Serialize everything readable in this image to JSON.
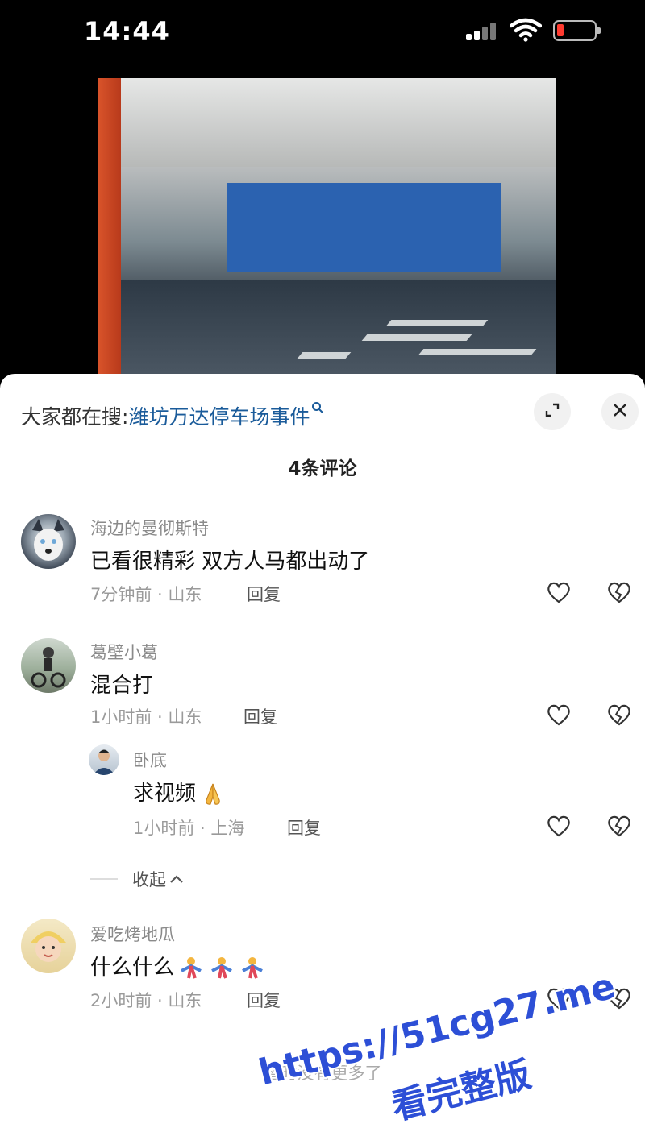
{
  "status_bar": {
    "time": "14:44"
  },
  "search": {
    "prefix": "大家都在搜:",
    "term": "潍坊万达停车场事件"
  },
  "comments_header": {
    "count_label": "4条评论"
  },
  "comments": [
    {
      "username": "海边的曼彻斯特",
      "text": "已看很精彩 双方人马都出动了",
      "time_location": "7分钟前 · 山东",
      "reply_label": "回复"
    },
    {
      "username": "葛壁小葛",
      "text": "混合打",
      "time_location": "1小时前 · 山东",
      "reply_label": "回复"
    },
    {
      "username": "卧底",
      "text": "求视频",
      "time_location": "1小时前 · 上海",
      "reply_label": "回复"
    },
    {
      "username": "爱吃烤地瓜",
      "text": "什么什么",
      "time_location": "2小时前 · 山东",
      "reply_label": "回复"
    }
  ],
  "collapse_label": "收起",
  "no_more_label": "暂时没有更多了",
  "watermark": {
    "url": "https://51cg27.me",
    "caption": "看完整版"
  },
  "colors": {
    "search_term": "#1a5b9a",
    "watermark": "#2d4fd6",
    "battery_low": "#ff3b30"
  },
  "icons": [
    "wifi-icon",
    "battery-icon",
    "expand-icon",
    "close-icon",
    "heart-icon",
    "broken-heart-icon",
    "search-icon",
    "chevron-up-icon"
  ]
}
